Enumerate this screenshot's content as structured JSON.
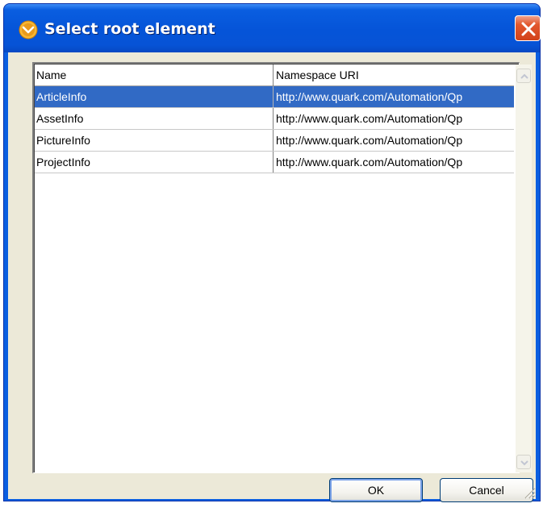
{
  "window": {
    "title": "Select root element"
  },
  "table": {
    "columns": [
      "Name",
      "Namespace URI"
    ],
    "rows": [
      {
        "name": "ArticleInfo",
        "namespace": "http://www.quark.com/Automation/Qp",
        "selected": true
      },
      {
        "name": "AssetInfo",
        "namespace": "http://www.quark.com/Automation/Qp",
        "selected": false
      },
      {
        "name": "PictureInfo",
        "namespace": "http://www.quark.com/Automation/Qp",
        "selected": false
      },
      {
        "name": "ProjectInfo",
        "namespace": "http://www.quark.com/Automation/Qp",
        "selected": false
      }
    ]
  },
  "buttons": {
    "ok_label": "OK",
    "cancel_label": "Cancel"
  },
  "colors": {
    "titlebar": "#0554d8",
    "selection": "#316ac5",
    "dialog_face": "#ece9d8",
    "close_button": "#d2421a"
  },
  "icons": {
    "app": "quark-app-icon",
    "close": "close-icon",
    "scroll_up": "scroll-up-icon",
    "scroll_down": "scroll-down-icon",
    "resize": "resize-grip-icon"
  }
}
